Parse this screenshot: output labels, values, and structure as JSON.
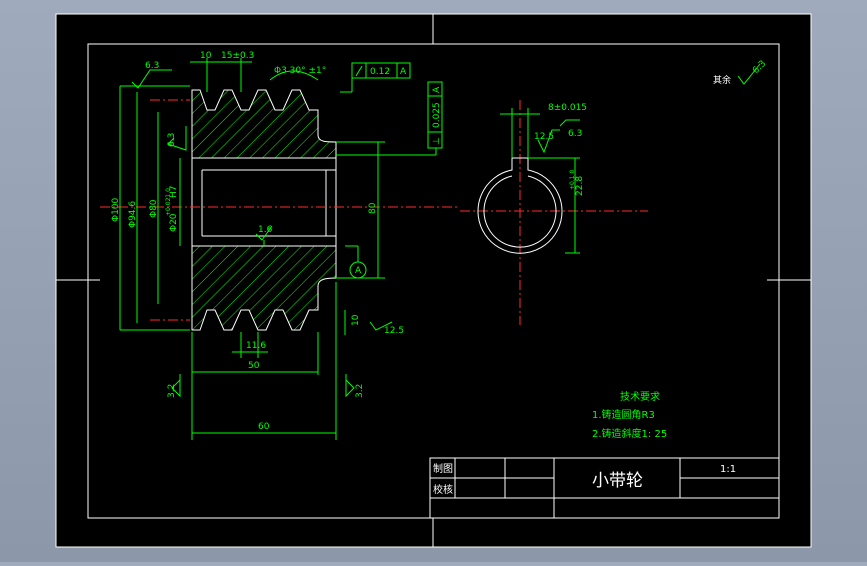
{
  "dims": {
    "width_10": "10",
    "pitch": "15±0.3",
    "angle": "Φ3 30° ±1°",
    "diam_100": "Φ100",
    "diam_94": "Φ94.6",
    "diam_80": "Φ80",
    "bore": "Φ20",
    "bore_fit": "H7",
    "bore_tol": "+0.021 0",
    "length_80": "80",
    "groove": "11.6",
    "len_50": "50",
    "len_60": "60",
    "len_10": "10",
    "key_width": "8±0.015",
    "key_depth": "22.8",
    "key_depth_tol": "+0.1 0",
    "datum_a": "A"
  },
  "roughness": {
    "r63_top": "6.3",
    "r63_side": "6.3",
    "r16": "1.6",
    "r125": "12.5",
    "r32_left": "3.2",
    "r32_right": "3.2",
    "r125_key": "12.5",
    "r63_key": "6.3",
    "other": "其余",
    "r63_other": "6.3"
  },
  "tolerances": {
    "runout": "0.12",
    "runout_ref": "A",
    "perp": "0.025",
    "perp_ref": "A"
  },
  "notes": {
    "title": "技术要求",
    "line1": "1.铸造圆角R3",
    "line2": "2.铸造斜度1: 25"
  },
  "title_block": {
    "drawn": "制图",
    "checked": "校核",
    "part_name": "小带轮",
    "scale": "1:1"
  }
}
